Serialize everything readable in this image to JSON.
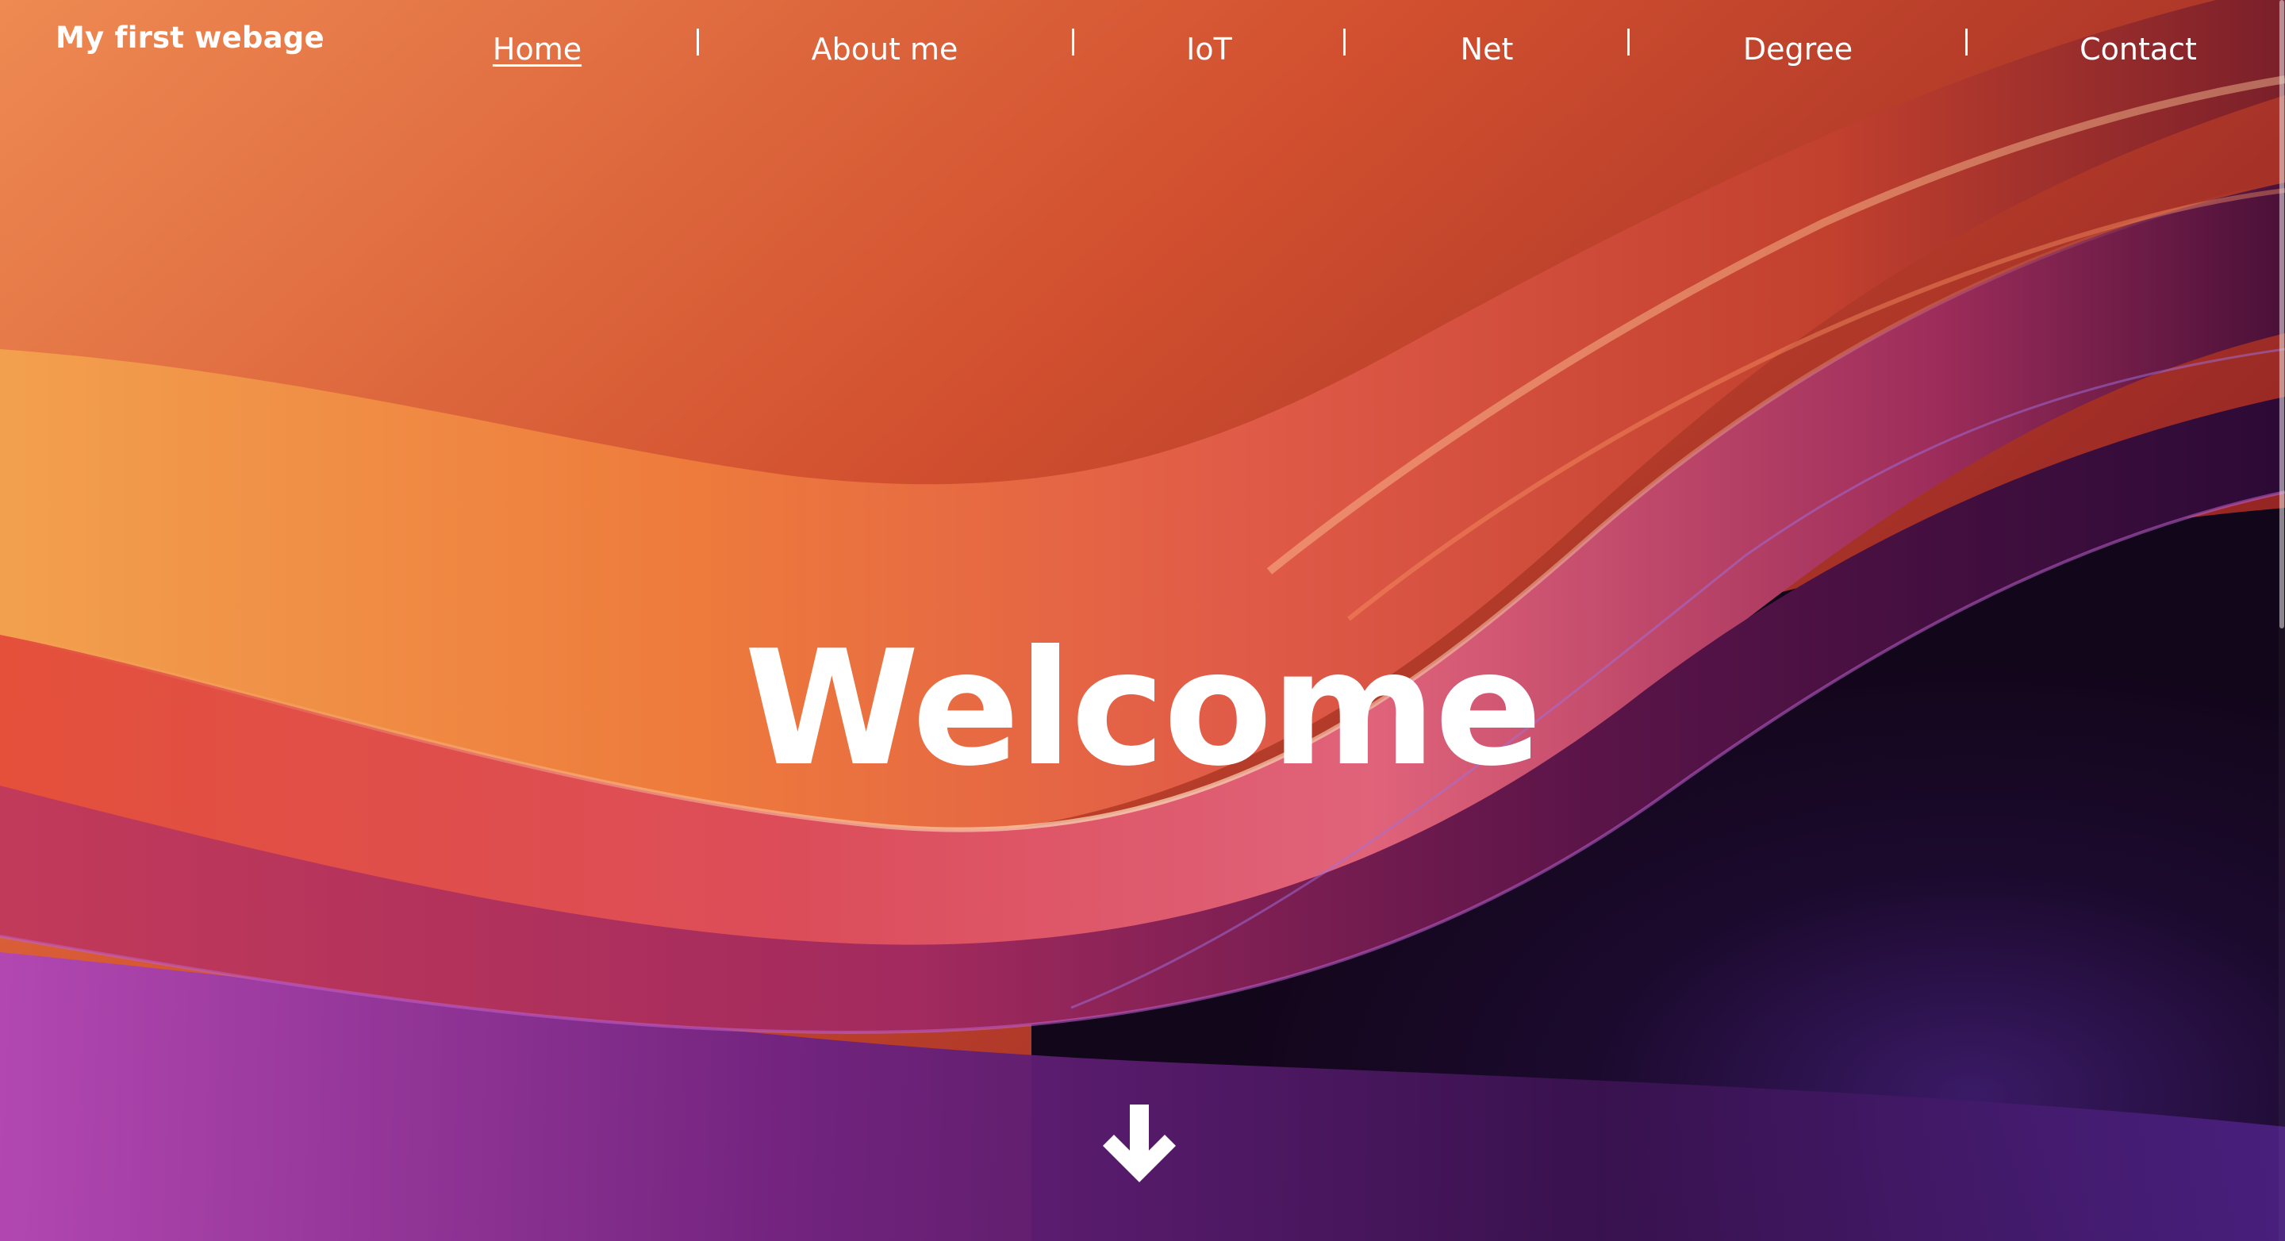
{
  "site": {
    "brand": "My first webage"
  },
  "nav": {
    "items": [
      {
        "label": "Home",
        "active": true
      },
      {
        "label": "About me",
        "active": false
      },
      {
        "label": "IoT",
        "active": false
      },
      {
        "label": "Net",
        "active": false
      },
      {
        "label": "Degree",
        "active": false
      },
      {
        "label": "Contact",
        "active": false
      }
    ]
  },
  "hero": {
    "heading": "Welcome",
    "scroll_icon": "arrow-down-icon"
  },
  "colors": {
    "text": "#ffffff",
    "orange": "#e8783c",
    "red": "#c8382a",
    "pink": "#d9557a",
    "purple": "#7a2a8a",
    "dark": "#1a0822"
  }
}
